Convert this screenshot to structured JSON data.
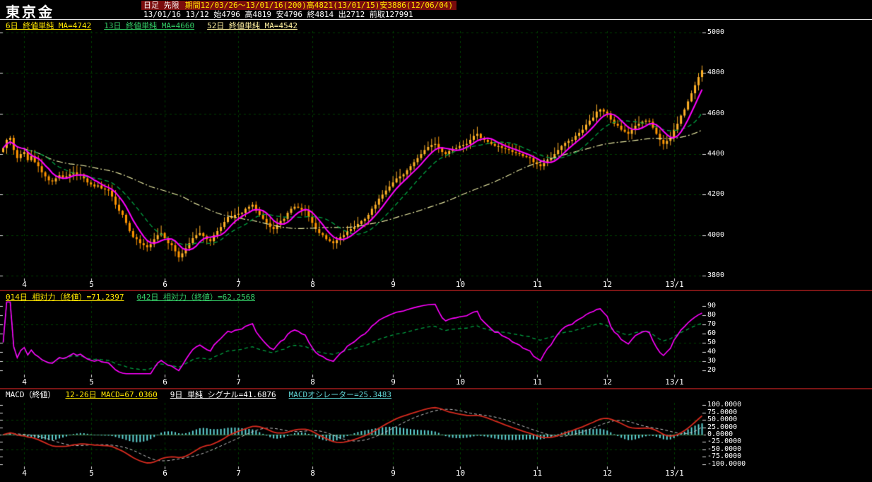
{
  "header": {
    "title": "東京金",
    "period_type": "日足 先限",
    "period_range": "期間12/03/26～13/01/16(200)高4821(13/01/15)安3886(12/06/04)",
    "quote_line": "13/01/16 13/12 始4796 高4819 安4796 終4814 出2712 前取127991"
  },
  "main_chart": {
    "legend": [
      {
        "label": "6日 終値単純 MA=4742",
        "color": "#ffe600"
      },
      {
        "label": "13日 終値単純 MA=4660",
        "color": "#33cc66"
      },
      {
        "label": "52日 終値単純 MA=4542",
        "color": "#fff0a0"
      }
    ]
  },
  "rsi_panel": {
    "legend": [
      {
        "label": "014日 相対力（終値）=71.2397",
        "color": "#ffe600"
      },
      {
        "label": "042日 相対力（終値）=62.2568",
        "color": "#33cc66"
      }
    ]
  },
  "macd_panel": {
    "title": "MACD（終値）",
    "legend": [
      {
        "label": "12-26日 MACD=67.0360",
        "color": "#ffe600"
      },
      {
        "label": "9日 単純 シグナル=41.6876",
        "color": "#ffffff"
      },
      {
        "label": "MACDオシレーター=25.3483",
        "color": "#5fd3d3"
      }
    ]
  },
  "chart_data": {
    "type": "candlestick",
    "instrument": "東京金",
    "timeframe": "日足 先限",
    "period_label": "期間12/03/26～13/01/16(200)",
    "x_ticks": [
      {
        "label": "4",
        "i": 6
      },
      {
        "label": "5",
        "i": 25
      },
      {
        "label": "6",
        "i": 46
      },
      {
        "label": "7",
        "i": 67
      },
      {
        "label": "8",
        "i": 88
      },
      {
        "label": "9",
        "i": 111
      },
      {
        "label": "10",
        "i": 130
      },
      {
        "label": "11",
        "i": 152
      },
      {
        "label": "12",
        "i": 172
      },
      {
        "label": "13/1",
        "i": 191
      }
    ],
    "main": {
      "ylim": [
        3800,
        5000
      ],
      "y_ticks": [
        "5000",
        "4800",
        "4600",
        "4400",
        "4200",
        "4000",
        "3800"
      ],
      "last_bar": {
        "date": "13/01/16",
        "open": 4796,
        "high": 4819,
        "low": 4796,
        "close": 4814,
        "volume": 2712,
        "open_interest": 127991
      },
      "period_high": {
        "value": 4821,
        "date": "13/01/15"
      },
      "period_low": {
        "value": 3886,
        "date": "12/06/04"
      },
      "moving_averages": [
        {
          "period": 6,
          "method": "終値単純",
          "value": 4742,
          "color": "#ff00ff",
          "style": "solid"
        },
        {
          "period": 13,
          "method": "終値単純",
          "value": 4660,
          "color": "#00a040",
          "style": "dashed"
        },
        {
          "period": 52,
          "method": "終値単純",
          "value": 4542,
          "color": "#e6e6a0",
          "style": "dash-dot"
        }
      ],
      "closes": [
        4430,
        4470,
        4480,
        4420,
        4380,
        4400,
        4410,
        4370,
        4390,
        4360,
        4340,
        4310,
        4290,
        4270,
        4265,
        4280,
        4295,
        4285,
        4290,
        4300,
        4310,
        4295,
        4300,
        4280,
        4260,
        4250,
        4240,
        4245,
        4230,
        4225,
        4220,
        4190,
        4150,
        4120,
        4100,
        4060,
        4020,
        3990,
        3980,
        3960,
        3950,
        3940,
        3955,
        3980,
        4000,
        4010,
        3985,
        3960,
        3950,
        3920,
        3890,
        3910,
        3935,
        3960,
        3985,
        4000,
        4010,
        3995,
        3980,
        3970,
        4000,
        4020,
        4040,
        4065,
        4090,
        4085,
        4100,
        4105,
        4110,
        4130,
        4140,
        4150,
        4120,
        4100,
        4080,
        4060,
        4040,
        4030,
        4050,
        4070,
        4080,
        4110,
        4130,
        4140,
        4135,
        4125,
        4120,
        4090,
        4060,
        4030,
        4010,
        4000,
        3980,
        3970,
        3960,
        3975,
        3990,
        4000,
        4020,
        4030,
        4040,
        4055,
        4070,
        4080,
        4100,
        4130,
        4150,
        4180,
        4200,
        4220,
        4240,
        4260,
        4280,
        4290,
        4300,
        4320,
        4340,
        4360,
        4380,
        4400,
        4420,
        4435,
        4445,
        4450,
        4430,
        4410,
        4400,
        4415,
        4425,
        4430,
        4440,
        4445,
        4450,
        4470,
        4490,
        4500,
        4480,
        4470,
        4460,
        4450,
        4440,
        4440,
        4430,
        4425,
        4420,
        4410,
        4405,
        4400,
        4390,
        4385,
        4380,
        4360,
        4350,
        4340,
        4355,
        4370,
        4380,
        4400,
        4420,
        4440,
        4455,
        4465,
        4470,
        4490,
        4505,
        4520,
        4545,
        4565,
        4580,
        4610,
        4620,
        4610,
        4600,
        4570,
        4550,
        4540,
        4520,
        4510,
        4500,
        4520,
        4540,
        4550,
        4560,
        4565,
        4560,
        4530,
        4500,
        4470,
        4450,
        4465,
        4480,
        4520,
        4550,
        4590,
        4620,
        4660,
        4700,
        4740,
        4780,
        4814
      ]
    },
    "rsi": {
      "ylim": [
        20,
        90
      ],
      "y_ticks": [
        "90",
        "80",
        "70",
        "60",
        "50",
        "40",
        "30",
        "20"
      ],
      "series": [
        {
          "name": "14日 相対力（終値）",
          "period": 14,
          "value": 71.2397,
          "color": "#ff00ff",
          "style": "solid"
        },
        {
          "name": "42日 相対力（終値）",
          "period": 42,
          "value": 62.2568,
          "color": "#00a040",
          "style": "dashed"
        }
      ]
    },
    "macd": {
      "ylim": [
        -100,
        100
      ],
      "y_ticks": [
        "100.0000",
        "75.0000",
        "50.0000",
        "25.0000",
        "0.0000",
        "-25.0000",
        "-50.0000",
        "-75.0000",
        "-100.0000"
      ],
      "macd_line": {
        "label": "12-26日 MACD",
        "value": 67.036,
        "color": "#d42a1e"
      },
      "signal": {
        "label": "9日 単純 シグナル",
        "value": 41.6876,
        "color": "#c8c8c8"
      },
      "oscillator": {
        "label": "MACDオシレーター",
        "value": 25.3483,
        "color": "#5fd3d3"
      }
    },
    "colors": {
      "background": "#000000",
      "candle_up": "#ffb028",
      "candle_down": "#ff9500",
      "grid": "#003f00",
      "separator": "#7a1515",
      "axis_text": "#ffffff"
    }
  }
}
